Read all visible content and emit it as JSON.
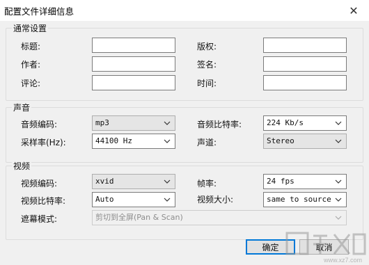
{
  "window": {
    "title": "配置文件详细信息",
    "close_glyph": "✕"
  },
  "general": {
    "legend": "通常设置",
    "fields": [
      {
        "label": "标题:",
        "value": ""
      },
      {
        "label": "作者:",
        "value": ""
      },
      {
        "label": "评论:",
        "value": ""
      },
      {
        "label": "版权:",
        "value": ""
      },
      {
        "label": "签名:",
        "value": ""
      },
      {
        "label": "时间:",
        "value": ""
      }
    ]
  },
  "audio": {
    "legend": "声音",
    "codec_label": "音频编码:",
    "codec_value": "mp3",
    "bitrate_label": "音频比特率:",
    "bitrate_value": "224 Kb/s",
    "samplerate_label": "采样率(Hz):",
    "samplerate_value": "44100 Hz",
    "channels_label": "声道:",
    "channels_value": "Stereo"
  },
  "video": {
    "legend": "视频",
    "codec_label": "视频编码:",
    "codec_value": "xvid",
    "framerate_label": "帧率:",
    "framerate_value": "24 fps",
    "bitrate_label": "视频比特率:",
    "bitrate_value": "Auto",
    "size_label": "视频大小:",
    "size_value": "same to source",
    "mask_label": "遮幕模式:",
    "mask_value": "剪切到全屏(Pan & Scan)"
  },
  "buttons": {
    "ok": "确定",
    "cancel": "取消"
  },
  "watermark": {
    "text": "www.xz7.com"
  },
  "colors": {
    "accent": "#0078d7",
    "background": "#f0f0f0"
  }
}
